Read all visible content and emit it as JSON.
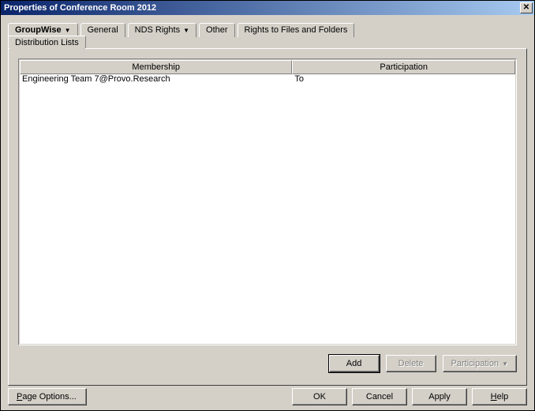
{
  "titlebar": {
    "title": "Properties of Conference Room 2012",
    "close": "X"
  },
  "tabs": {
    "groupwise": "GroupWise",
    "general": "General",
    "nds": "NDS Rights",
    "other": "Other",
    "rights": "Rights to Files and Folders"
  },
  "subtab": {
    "distlists": "Distribution Lists"
  },
  "grid": {
    "header_membership": "Membership",
    "header_participation": "Participation",
    "rows": [
      {
        "membership": "Engineering Team 7@Provo.Research",
        "participation": "To"
      }
    ]
  },
  "actions": {
    "add": "Add",
    "delete": "Delete",
    "participation": "Participation"
  },
  "bottom": {
    "page_options_prefix": "P",
    "page_options_rest": "age Options...",
    "ok": "OK",
    "cancel": "Cancel",
    "apply": "Apply",
    "help_prefix": "H",
    "help_rest": "elp"
  }
}
